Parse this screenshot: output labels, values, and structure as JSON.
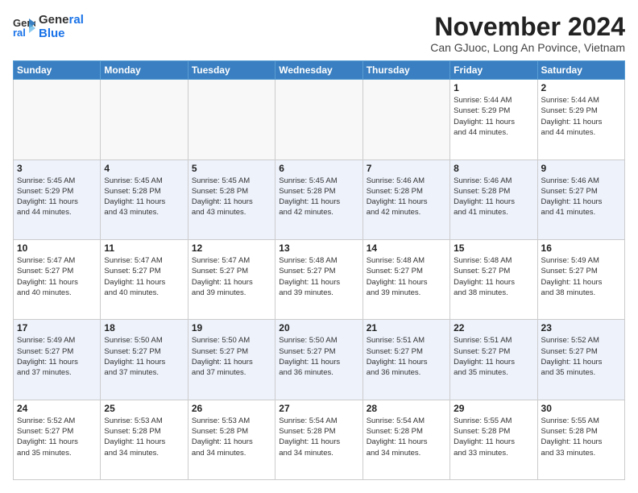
{
  "header": {
    "logo_line1": "General",
    "logo_line2": "Blue",
    "month": "November 2024",
    "location": "Can GJuoc, Long An Povince, Vietnam"
  },
  "weekdays": [
    "Sunday",
    "Monday",
    "Tuesday",
    "Wednesday",
    "Thursday",
    "Friday",
    "Saturday"
  ],
  "weeks": [
    [
      {
        "day": "",
        "info": ""
      },
      {
        "day": "",
        "info": ""
      },
      {
        "day": "",
        "info": ""
      },
      {
        "day": "",
        "info": ""
      },
      {
        "day": "",
        "info": ""
      },
      {
        "day": "1",
        "info": "Sunrise: 5:44 AM\nSunset: 5:29 PM\nDaylight: 11 hours\nand 44 minutes."
      },
      {
        "day": "2",
        "info": "Sunrise: 5:44 AM\nSunset: 5:29 PM\nDaylight: 11 hours\nand 44 minutes."
      }
    ],
    [
      {
        "day": "3",
        "info": "Sunrise: 5:45 AM\nSunset: 5:29 PM\nDaylight: 11 hours\nand 44 minutes."
      },
      {
        "day": "4",
        "info": "Sunrise: 5:45 AM\nSunset: 5:28 PM\nDaylight: 11 hours\nand 43 minutes."
      },
      {
        "day": "5",
        "info": "Sunrise: 5:45 AM\nSunset: 5:28 PM\nDaylight: 11 hours\nand 43 minutes."
      },
      {
        "day": "6",
        "info": "Sunrise: 5:45 AM\nSunset: 5:28 PM\nDaylight: 11 hours\nand 42 minutes."
      },
      {
        "day": "7",
        "info": "Sunrise: 5:46 AM\nSunset: 5:28 PM\nDaylight: 11 hours\nand 42 minutes."
      },
      {
        "day": "8",
        "info": "Sunrise: 5:46 AM\nSunset: 5:28 PM\nDaylight: 11 hours\nand 41 minutes."
      },
      {
        "day": "9",
        "info": "Sunrise: 5:46 AM\nSunset: 5:27 PM\nDaylight: 11 hours\nand 41 minutes."
      }
    ],
    [
      {
        "day": "10",
        "info": "Sunrise: 5:47 AM\nSunset: 5:27 PM\nDaylight: 11 hours\nand 40 minutes."
      },
      {
        "day": "11",
        "info": "Sunrise: 5:47 AM\nSunset: 5:27 PM\nDaylight: 11 hours\nand 40 minutes."
      },
      {
        "day": "12",
        "info": "Sunrise: 5:47 AM\nSunset: 5:27 PM\nDaylight: 11 hours\nand 39 minutes."
      },
      {
        "day": "13",
        "info": "Sunrise: 5:48 AM\nSunset: 5:27 PM\nDaylight: 11 hours\nand 39 minutes."
      },
      {
        "day": "14",
        "info": "Sunrise: 5:48 AM\nSunset: 5:27 PM\nDaylight: 11 hours\nand 39 minutes."
      },
      {
        "day": "15",
        "info": "Sunrise: 5:48 AM\nSunset: 5:27 PM\nDaylight: 11 hours\nand 38 minutes."
      },
      {
        "day": "16",
        "info": "Sunrise: 5:49 AM\nSunset: 5:27 PM\nDaylight: 11 hours\nand 38 minutes."
      }
    ],
    [
      {
        "day": "17",
        "info": "Sunrise: 5:49 AM\nSunset: 5:27 PM\nDaylight: 11 hours\nand 37 minutes."
      },
      {
        "day": "18",
        "info": "Sunrise: 5:50 AM\nSunset: 5:27 PM\nDaylight: 11 hours\nand 37 minutes."
      },
      {
        "day": "19",
        "info": "Sunrise: 5:50 AM\nSunset: 5:27 PM\nDaylight: 11 hours\nand 37 minutes."
      },
      {
        "day": "20",
        "info": "Sunrise: 5:50 AM\nSunset: 5:27 PM\nDaylight: 11 hours\nand 36 minutes."
      },
      {
        "day": "21",
        "info": "Sunrise: 5:51 AM\nSunset: 5:27 PM\nDaylight: 11 hours\nand 36 minutes."
      },
      {
        "day": "22",
        "info": "Sunrise: 5:51 AM\nSunset: 5:27 PM\nDaylight: 11 hours\nand 35 minutes."
      },
      {
        "day": "23",
        "info": "Sunrise: 5:52 AM\nSunset: 5:27 PM\nDaylight: 11 hours\nand 35 minutes."
      }
    ],
    [
      {
        "day": "24",
        "info": "Sunrise: 5:52 AM\nSunset: 5:27 PM\nDaylight: 11 hours\nand 35 minutes."
      },
      {
        "day": "25",
        "info": "Sunrise: 5:53 AM\nSunset: 5:28 PM\nDaylight: 11 hours\nand 34 minutes."
      },
      {
        "day": "26",
        "info": "Sunrise: 5:53 AM\nSunset: 5:28 PM\nDaylight: 11 hours\nand 34 minutes."
      },
      {
        "day": "27",
        "info": "Sunrise: 5:54 AM\nSunset: 5:28 PM\nDaylight: 11 hours\nand 34 minutes."
      },
      {
        "day": "28",
        "info": "Sunrise: 5:54 AM\nSunset: 5:28 PM\nDaylight: 11 hours\nand 34 minutes."
      },
      {
        "day": "29",
        "info": "Sunrise: 5:55 AM\nSunset: 5:28 PM\nDaylight: 11 hours\nand 33 minutes."
      },
      {
        "day": "30",
        "info": "Sunrise: 5:55 AM\nSunset: 5:28 PM\nDaylight: 11 hours\nand 33 minutes."
      }
    ]
  ]
}
